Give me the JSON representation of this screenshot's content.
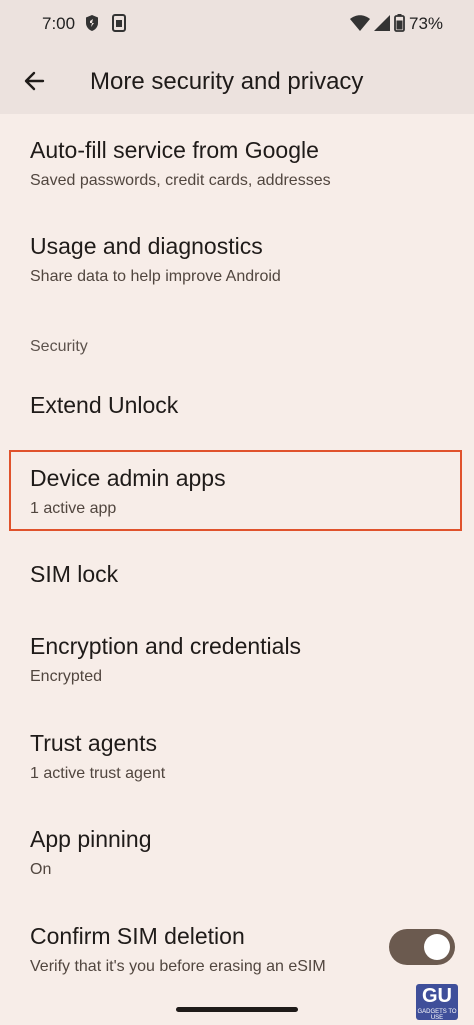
{
  "status_bar": {
    "time": "7:00",
    "battery": "73%",
    "icons": [
      "shield-icon",
      "sim-card-icon",
      "wifi-icon",
      "signal-icon",
      "battery-icon"
    ]
  },
  "header": {
    "title": "More security and privacy",
    "back_icon": "arrow-left-icon"
  },
  "items": [
    {
      "title": "Auto-fill service from Google",
      "subtitle": "Saved passwords, credit cards, addresses"
    },
    {
      "title": "Usage and diagnostics",
      "subtitle": "Share data to help improve Android"
    }
  ],
  "section": {
    "label": "Security"
  },
  "security_items": [
    {
      "title": "Extend Unlock"
    },
    {
      "title": "Device admin apps",
      "subtitle": "1 active app",
      "highlighted": true
    },
    {
      "title": "SIM lock"
    },
    {
      "title": "Encryption and credentials",
      "subtitle": "Encrypted"
    },
    {
      "title": "Trust agents",
      "subtitle": "1 active trust agent"
    },
    {
      "title": "App pinning",
      "subtitle": "On"
    },
    {
      "title": "Confirm SIM deletion",
      "subtitle": "Verify that it's you before erasing an eSIM",
      "toggle": true
    }
  ],
  "watermark": {
    "logo": "GU",
    "tagline": "GADGETS TO USE"
  },
  "colors": {
    "background": "#f7ede8",
    "header": "#ece2de",
    "highlight": "#e0522c",
    "toggle_on": "#6b5a4f"
  }
}
